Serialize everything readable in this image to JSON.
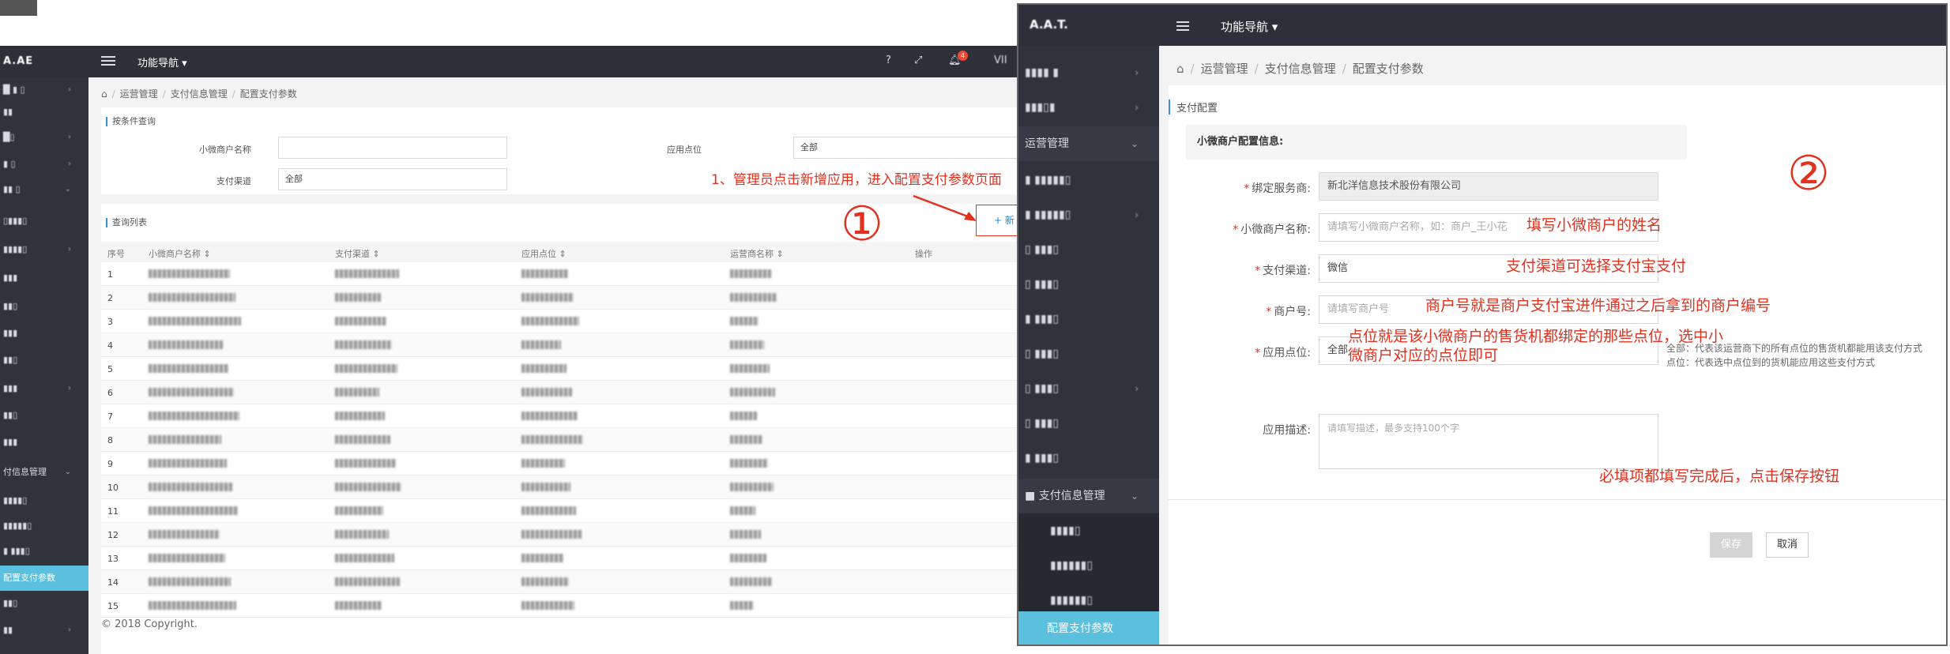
{
  "left": {
    "topbar": {
      "func_nav_label": "功能导航 ▾",
      "help_icon": "?",
      "expand_icon": "⤢",
      "notif_count": "4"
    },
    "breadcrumb": [
      "运营管理",
      "支付信息管理",
      "配置支付参数"
    ],
    "search": {
      "section_title": "按条件查询",
      "merchant_label": "小微商户名称",
      "point_label": "应用点位",
      "point_value": "全部",
      "channel_label": "支付渠道",
      "channel_value": "全部"
    },
    "list": {
      "section_title": "查询列表",
      "add_button": "+ 新",
      "columns": [
        "序号",
        "小微商户名称 ⇕",
        "支付渠道 ⇕",
        "应用点位 ⇕",
        "运营商名称 ⇕",
        "操作"
      ],
      "row_numbers": [
        "1",
        "2",
        "3",
        "4",
        "5",
        "6",
        "7",
        "8",
        "9",
        "10",
        "11",
        "12",
        "13",
        "14",
        "15"
      ]
    },
    "sidebar": {
      "active_item": "配置支付参数",
      "pay_group": "付信息管理"
    },
    "footer": "© 2018 Copyright."
  },
  "annotations": {
    "step1_text": "1、管理员点击新增应用，进入配置支付参数页面",
    "circle1": "①",
    "circle2": "②",
    "merchant_note": "填写小微商户的姓名",
    "channel_note": "支付渠道可选择支付宝支付",
    "merchant_no_note": "商户号就是商户支付宝进件通过之后拿到的商户编号",
    "point_note": "点位就是该小微商户的售货机都绑定的那些点位，选中小微商户对应的点位即可",
    "save_note": "必填项都填写完成后，点击保存按钮"
  },
  "right": {
    "topbar": {
      "func_nav_label": "功能导航 ▾"
    },
    "sidebar": {
      "ops_group": "运营管理",
      "pay_group": "支付信息管理",
      "active_item": "配置支付参数"
    },
    "breadcrumb": [
      "运营管理",
      "支付信息管理",
      "配置支付参数"
    ],
    "section_title": "支付配置",
    "config_header": "小微商户配置信息:",
    "form": {
      "provider_label": "绑定服务商:",
      "provider_value": "新北洋信息技术股份有限公司",
      "merchant_label": "小微商户名称:",
      "merchant_placeholder": "请填写小微商户名称，如：商户_王小花",
      "channel_label": "支付渠道:",
      "channel_value": "微信",
      "merchant_no_label": "商户号:",
      "merchant_no_placeholder": "请填写商户号",
      "point_label": "应用点位:",
      "point_value": "全部",
      "point_hint_1": "全部：代表该运营商下的所有点位的售货机都能用该支付方式",
      "point_hint_2": "点位：代表选中点位到的货机能应用这些支付方式",
      "desc_label": "应用描述:",
      "desc_placeholder": "请填写描述，最多支持100个字"
    },
    "buttons": {
      "save": "保存",
      "cancel": "取消"
    }
  },
  "colors": {
    "annotation": "#e0321f",
    "sidebar": "#2f333c",
    "topbar": "#2d3038",
    "active": "#5bc0de"
  }
}
